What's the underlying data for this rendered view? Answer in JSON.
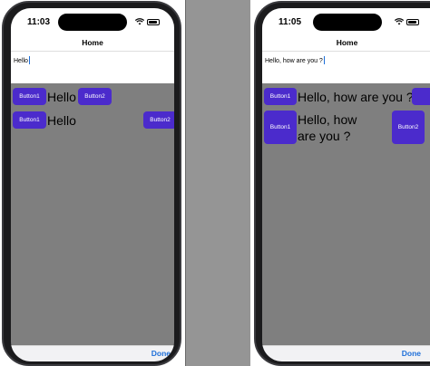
{
  "left": {
    "status_time": "11:03",
    "nav_title": "Home",
    "editor_text": "Hello",
    "row1": {
      "button1": "Button1",
      "label": "Hello",
      "button2": "Button2"
    },
    "row2": {
      "button1": "Button1",
      "label": "Hello",
      "button2": "Button2"
    },
    "done_label": "Done"
  },
  "right": {
    "status_time": "11:05",
    "nav_title": "Home",
    "editor_text": "Hello, how are you ?",
    "row1": {
      "button1": "Button1",
      "label": "Hello, how are you ?"
    },
    "row2": {
      "button1": "Button1",
      "label_line1": "Hello, how",
      "label_line2": "are you ?",
      "button2": "Button2"
    },
    "done_label": "Done"
  },
  "colors": {
    "button": "#4b2bcc",
    "accent": "#1e6fd9",
    "content_bg": "#7f7f7f"
  }
}
